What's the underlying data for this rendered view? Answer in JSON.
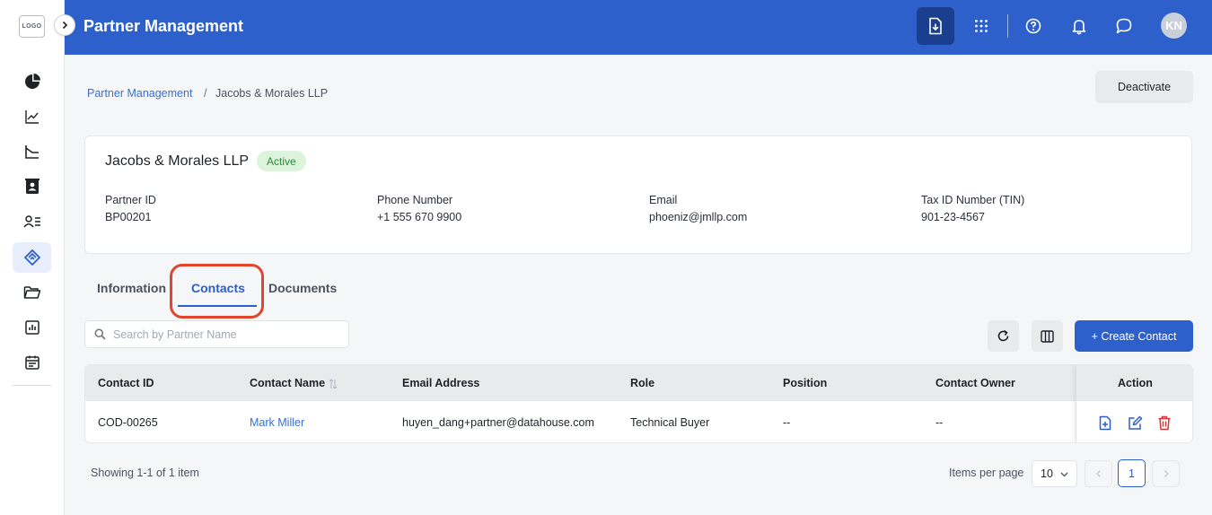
{
  "app": {
    "logo_text": "LOGO",
    "title": "Partner Management",
    "avatar_initials": "KN"
  },
  "topbar_icons": [
    "download-icon",
    "apps-grid-icon",
    "help-icon",
    "bell-icon",
    "chat-icon"
  ],
  "sidebar": {
    "items": [
      {
        "icon": "pie-chart-icon",
        "active": false
      },
      {
        "icon": "trend-line-icon",
        "active": false
      },
      {
        "icon": "chart-axes-icon",
        "active": false
      },
      {
        "icon": "contact-book-icon",
        "active": false
      },
      {
        "icon": "user-list-icon",
        "active": false
      },
      {
        "icon": "handshake-tag-icon",
        "active": true
      },
      {
        "icon": "folder-open-icon",
        "active": false
      },
      {
        "icon": "bar-report-icon",
        "active": false
      },
      {
        "icon": "calendar-icon",
        "active": false
      }
    ]
  },
  "breadcrumb": {
    "parent": "Partner Management",
    "separator": "/",
    "current": "Jacobs & Morales LLP"
  },
  "deactivate_label": "Deactivate",
  "partner": {
    "name": "Jacobs & Morales LLP",
    "status": "Active",
    "fields": [
      {
        "label": "Partner ID",
        "value": "BP00201"
      },
      {
        "label": "Phone Number",
        "value": "+1 555 670 9900"
      },
      {
        "label": "Email",
        "value": "phoeniz@jmllp.com"
      },
      {
        "label": "Tax ID Number (TIN)",
        "value": "901-23-4567"
      }
    ]
  },
  "tabs": [
    {
      "label": "Information",
      "active": false
    },
    {
      "label": "Contacts",
      "active": true
    },
    {
      "label": "Documents",
      "active": false
    }
  ],
  "search": {
    "placeholder": "Search by Partner Name",
    "value": ""
  },
  "create_label": "+ Create Contact",
  "table": {
    "columns": [
      "Contact ID",
      "Contact Name",
      "Email Address",
      "Role",
      "Position",
      "Contact Owner",
      "Action"
    ],
    "rows": [
      {
        "contact_id": "COD-00265",
        "contact_name": "Mark Miller",
        "email": "huyen_dang+partner@datahouse.com",
        "role": "Technical Buyer",
        "position": "--",
        "owner": "--"
      }
    ]
  },
  "pagination": {
    "showing": "Showing 1-1 of 1 item",
    "items_per_page_label": "Items per page",
    "items_per_page": "10",
    "current_page": "1"
  },
  "colors": {
    "brand": "#2e60cc",
    "brand_dark": "#1b3f8f",
    "active_badge_bg": "#dcf3dc",
    "active_badge_text": "#2f8a3a",
    "delete": "#d6333a",
    "highlight": "#e2452c"
  }
}
